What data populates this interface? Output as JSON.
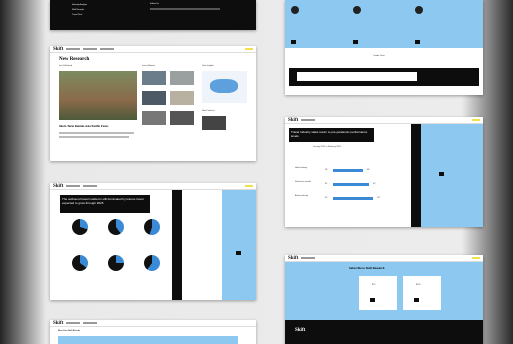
{
  "card_top_left": {
    "footer_links": [
      "Industry Analysis",
      "Skift Records",
      "Travel Tech"
    ],
    "follow_us": "Follow Us"
  },
  "card_research": {
    "page_title": "New Research",
    "col_just_published": "Just Published",
    "col_latest_reports": "Latest Reports",
    "col_data_insights": "Data Insights",
    "feature_title": "Short-Term Rentals Asia Pacific Focus",
    "col_new_products": "New Products"
  },
  "card_top_right": {
    "section_label": "Trends Pulse"
  },
  "card_charts": {
    "heading": "The outbound travel market is still dominated by leisure travel expected to grow through 2025"
  },
  "card_gauges": {
    "heading": "Travel industry sales return to pre-pandemic performance levels",
    "subtitle": "January 2021 to February 2023",
    "rows": [
      {
        "label": "Hotel industry",
        "a": "38.",
        "b": "48."
      },
      {
        "label": "Short-term rentals",
        "a": "81.",
        "b": "92."
      },
      {
        "label": "Airline industry",
        "a": "35.",
        "b": "117."
      }
    ]
  },
  "card_subscribe": {
    "heading": "Subscribe to Skift Research",
    "price_1": "$79",
    "price_2": "$199"
  },
  "card_bottom_left": {
    "heading": "Meet Your Skift Results"
  },
  "colors": {
    "accent_blue": "#8cc8f0",
    "accent_yellow": "#f2e14c",
    "dark": "#0d0d0d"
  }
}
